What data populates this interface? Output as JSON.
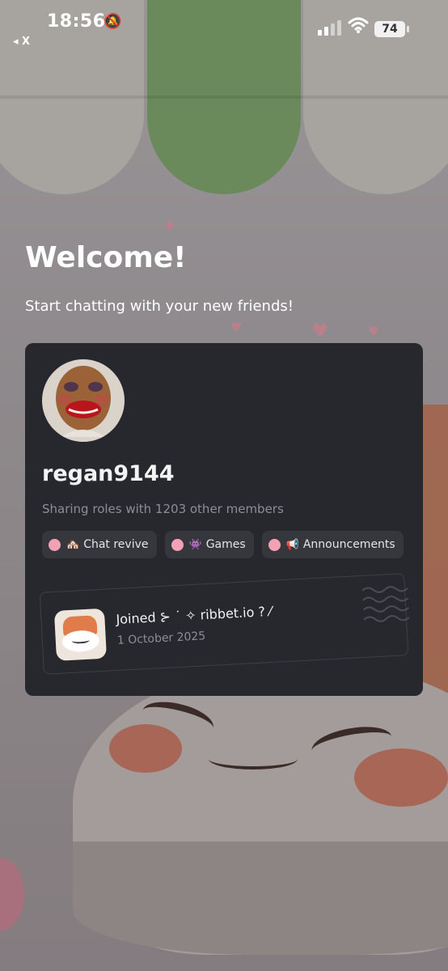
{
  "status_bar": {
    "time": "18:56",
    "back_label": "◂ X",
    "battery": "74"
  },
  "welcome": {
    "title": "Welcome!",
    "subtitle": "Start chatting with your new friends!"
  },
  "profile": {
    "username": "regan9144",
    "sharing_text": "Sharing roles with 1203 other members",
    "roles": [
      {
        "label": "Chat revive",
        "emoji": "🏘️",
        "dot_color": "#f4a0b5"
      },
      {
        "label": "Games",
        "emoji": "👾",
        "dot_color": "#f4a0b5"
      },
      {
        "label": "Announcements",
        "emoji": "📢",
        "dot_color": "#f4a0b5"
      }
    ],
    "joined": {
      "text": "Joined ⊱ ˙ ✧ ribbet.io ? ⁄",
      "date": "1 October 2025"
    }
  },
  "colors": {
    "card_bg": "#26282e",
    "role_bg": "#35373d",
    "role_dot": "#f4a0b5",
    "muted_text": "#8b8e96"
  }
}
